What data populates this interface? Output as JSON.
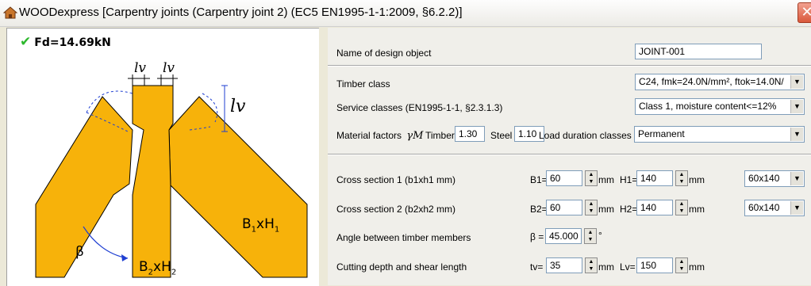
{
  "window": {
    "title": "WOODexpress   [Carpentry joints (Carpentry joint 2) (EC5 EN1995-1-1:2009, §6.2.2)]",
    "close_glyph": "✕"
  },
  "left": {
    "status_text": "Fd=14.69kN",
    "status_icon": "check-icon",
    "drawing": {
      "lv_top1": "lv",
      "lv_top2": "lv",
      "lv_right": "lv",
      "beta": "β",
      "b1h1_B": "B",
      "b1h1_sub1": "1",
      "b1h1_x": "xH",
      "b1h1_sub2": "1",
      "b2h2_B": "B",
      "b2h2_sub1": "2",
      "b2h2_x": "xH",
      "b2h2_sub2": "2"
    },
    "colors": {
      "timber": "#f7b20a",
      "outline": "#000000",
      "dim": "#1f3fd2"
    }
  },
  "right": {
    "name": {
      "label": "Name of design object",
      "value": "JOINT-001"
    },
    "timber_class": {
      "label": "Timber class",
      "value": "C24, fmk=24.0N/mm², ftok=14.0N/"
    },
    "service_class": {
      "label": "Service classes (EN1995-1-1, §2.3.1.3)",
      "value": "Class 1, moisture content<=12%"
    },
    "material": {
      "label": "Material factors",
      "gamma": "γM",
      "timber_label": "Timber",
      "timber_value": "1.30",
      "steel_label": "Steel",
      "steel_value": "1.10"
    },
    "load_duration": {
      "label": "Load duration classes",
      "value": "Permanent"
    },
    "cs1": {
      "label": "Cross section 1 (b1xh1 mm)",
      "b_label": "B1=",
      "b_value": "60",
      "h_label": "H1=",
      "h_value": "140",
      "unit": "mm",
      "preset": "60x140"
    },
    "cs2": {
      "label": "Cross section 2 (b2xh2 mm)",
      "b_label": "B2=",
      "b_value": "60",
      "h_label": "H2=",
      "h_value": "140",
      "unit": "mm",
      "preset": "60x140"
    },
    "angle": {
      "label": "Angle between timber members",
      "symbol": "β =",
      "value": "45.000",
      "unit": "°"
    },
    "cutting": {
      "label": "Cutting depth and shear length",
      "tv_label": "tv=",
      "tv_value": "35",
      "lv_label": "Lv=",
      "lv_value": "150",
      "unit": "mm"
    }
  }
}
